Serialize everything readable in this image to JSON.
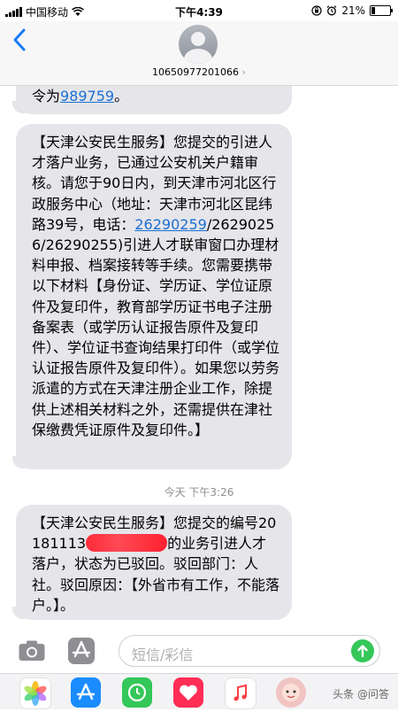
{
  "status_bar": {
    "carrier": "中国移动",
    "time": "下午4:39",
    "battery_percent": "21%",
    "battery_level": 0.21
  },
  "header": {
    "contact_number": "10650977201066",
    "chevron": "›"
  },
  "messages": [
    {
      "text_before_link": "令为",
      "link": "989759",
      "text_after_link": "。"
    },
    {
      "part1": "【天津公安民生服务】您提交的引进人才落户业务，已通过公安机关户籍审核。请您于90日内，到天津市河北区行政服务中心（地址：天津市河北区昆纬路39号，电话：",
      "phone_link": "26290259",
      "part2": "/26290256/26290255)引进人才联审窗口办理材料申报、档案接转等手续。您需要携带以下材料【身份证、学历证、学位证原件及复印件，教育部学历证书电子注册备案表（或学历认证报告原件及复印件）、学位证书查询结果打印件（或学位认证报告原件及复印件）。如果您以劳务派遣的方式在天津注册企业工作，除提供上述相关材料之外，还需提供在津社保缴费凭证原件及复印件。】"
    },
    {
      "part1": "【天津公安民生服务】您提交的编号20181113",
      "part2": "的业务引进人才落户，状态为已驳回。驳回部门：人社。驳回原因：【外省市有工作，不能落户。】。"
    }
  ],
  "timestamp": "今天 下午3:26",
  "composer": {
    "placeholder": "短信/彩信"
  },
  "icons": {
    "back": "chevron-left-icon",
    "camera": "camera-icon",
    "apps": "app-store-icon",
    "send": "send-arrow-icon"
  },
  "watermark": "头条 @问答",
  "colors": {
    "accent": "#1a7cf5",
    "bubble": "#e5e5ea",
    "send": "#35c759",
    "link": "#1a6fd1"
  }
}
